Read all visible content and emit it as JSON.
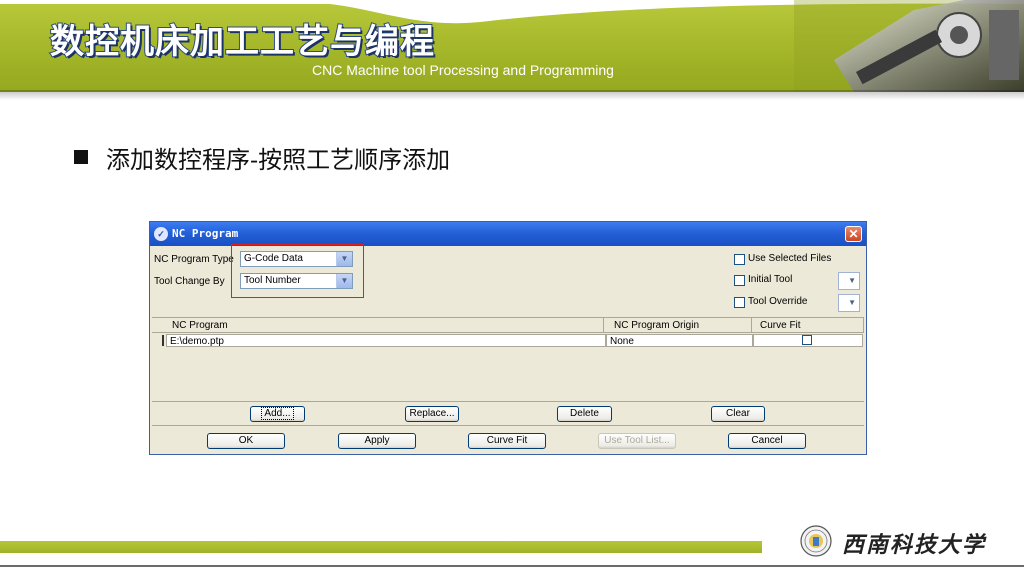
{
  "slide": {
    "title_zh": "数控机床加工工艺与编程",
    "title_en": "CNC Machine tool Processing and Programming",
    "heading": "添加数控程序-按照工艺顺序添加",
    "university": "西南科技大学",
    "colors": {
      "header_green": "#a4b629",
      "title_blue": "#2d4a8a",
      "highlight_red": "#e02020"
    }
  },
  "dialog": {
    "title": "NC Program",
    "title_icon": "app-icon",
    "nc_program_type_label": "NC Program Type",
    "nc_program_type_value": "G-Code Data",
    "tool_change_by_label": "Tool Change By",
    "tool_change_by_value": "Tool Number",
    "options": [
      {
        "label": "Use Selected Files",
        "checked": false
      },
      {
        "label": "Initial Tool",
        "checked": false
      },
      {
        "label": "Tool Override",
        "checked": false
      }
    ],
    "table": {
      "columns": [
        "NC Program",
        "NC Program Origin",
        "Curve Fit"
      ],
      "rows": [
        {
          "program": "E:\\demo.ptp",
          "origin": "None",
          "curve_fit": false
        }
      ]
    },
    "buttons_row1": [
      "Add...",
      "Replace...",
      "Delete",
      "Clear"
    ],
    "buttons_row2": [
      "OK",
      "Apply",
      "Curve Fit",
      "Use Tool List...",
      "Cancel"
    ]
  }
}
